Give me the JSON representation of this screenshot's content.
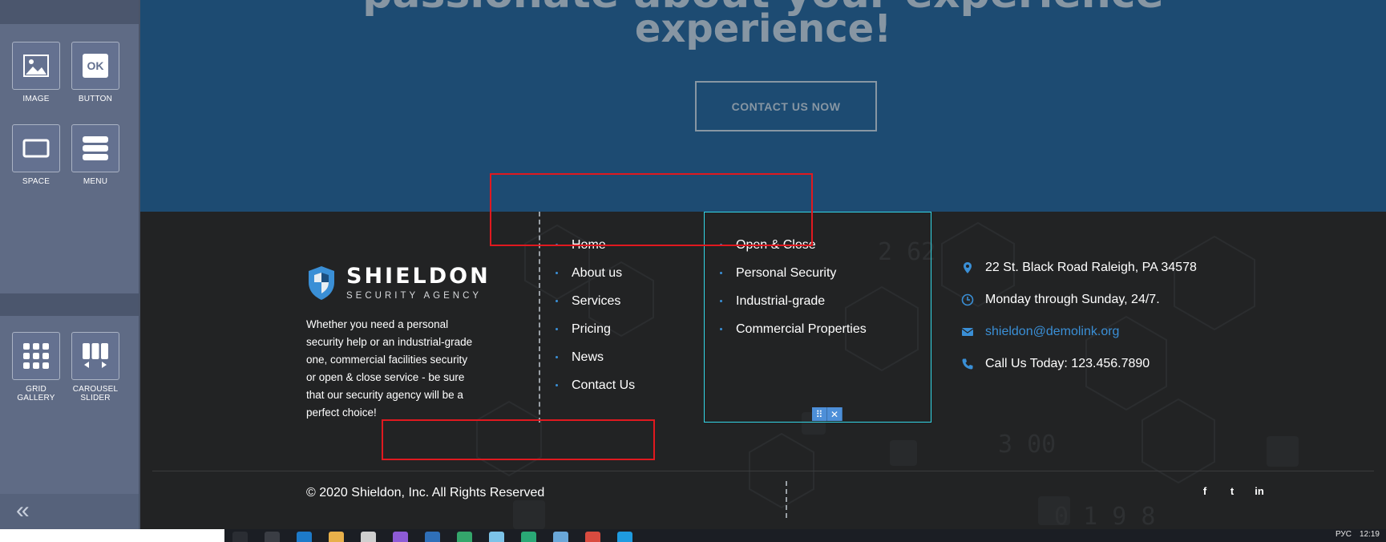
{
  "builder_panel": {
    "widgets": [
      {
        "label": "IMAGE",
        "icon": "image-icon"
      },
      {
        "label": "BUTTON",
        "icon": "ok-button-icon",
        "icon_text": "OK"
      },
      {
        "label": "SPACE",
        "icon": "space-icon"
      },
      {
        "label": "MENU",
        "icon": "menu-icon"
      },
      {
        "label": "GRID\nGALLERY",
        "icon": "grid-gallery-icon"
      },
      {
        "label": "CAROUSEL\nSLIDER",
        "icon": "carousel-slider-icon"
      }
    ],
    "collapse_glyph": "«"
  },
  "hero": {
    "partial_line": "passionate about your experience",
    "headline": "experience!",
    "cta_label": "CONTACT US NOW"
  },
  "footer": {
    "brand": {
      "name": "SHIELDON",
      "tagline": "SECURITY AGENCY",
      "about": "Whether you need a personal security help or an industrial-grade one, commercial facilities security or open & close service - be sure that our security agency will be a perfect choice!"
    },
    "nav_links": [
      "Home",
      "About us",
      "Services",
      "Pricing",
      "News",
      "Contact Us"
    ],
    "services_links": [
      "Open & Close",
      "Personal Security",
      "Industrial-grade",
      "Commercial Properties"
    ],
    "selection_tools": {
      "move_glyph": "⠿",
      "close_glyph": "✕"
    },
    "contact": {
      "address": "22 St. Black Road Raleigh, PA 34578",
      "hours": "Monday through Sunday, 24/7.",
      "email": "shieldon@demolink.org",
      "phone": "Call Us Today: 123.456.7890"
    },
    "copyright": "© 2020 Shieldon, Inc. All Rights Reserved",
    "social": [
      {
        "name": "facebook-icon",
        "glyph": "f"
      },
      {
        "name": "twitter-icon",
        "glyph": "t"
      },
      {
        "name": "linkedin-icon",
        "glyph": "in"
      }
    ]
  },
  "taskbar": {
    "search_text": "",
    "tray_lang": "РУС",
    "tray_time": "12:19"
  },
  "colors": {
    "hero_bg": "#1d4b72",
    "footer_bg": "#222324",
    "accent_blue": "#3a8fd6",
    "selection_cyan": "#33d6e6",
    "annotation_red": "#e0191f",
    "panel_bg": "#5f6b85"
  }
}
